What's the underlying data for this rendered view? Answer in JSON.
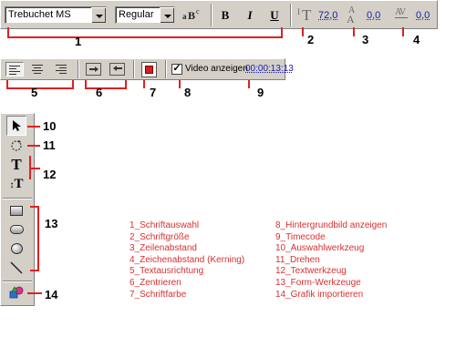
{
  "toolbar1": {
    "font_select": "Trebuchet MS",
    "style_select": "Regular",
    "bold_label": "B",
    "italic_label": "I",
    "underline_label": "U",
    "font_size": "72,0",
    "line_spacing": "0,0",
    "kerning": "0,0"
  },
  "toolbar2": {
    "video_checkbox_label": "Video anzeigen",
    "video_checked": true,
    "timecode": "00:00:13:13"
  },
  "callouts": [
    "1",
    "2",
    "3",
    "4",
    "5",
    "6",
    "7",
    "8",
    "9",
    "10",
    "11",
    "12",
    "13",
    "14"
  ],
  "legend": {
    "left": [
      "1_Schriftauswahl",
      "2_Schriftgröße",
      "3_Zeilenabstand",
      "4_Zeichenabstand (Kerning)",
      "5_Textausrichtung",
      "6_Zentrieren",
      "7_Schriftfarbe"
    ],
    "right": [
      "8_Hintergrundbild anzeigen",
      "9_Timecode",
      "10_Auswahlwerkzeug",
      "11_Drehen",
      "12_Textwerkzeug",
      "13_Form-Werkzeuge",
      "14_Grafik importieren"
    ]
  },
  "colors": {
    "annotation": "#e02020",
    "legend_text": "#d93030",
    "value_link": "#1a1aa8",
    "toolbar": "#d4d0c8"
  }
}
